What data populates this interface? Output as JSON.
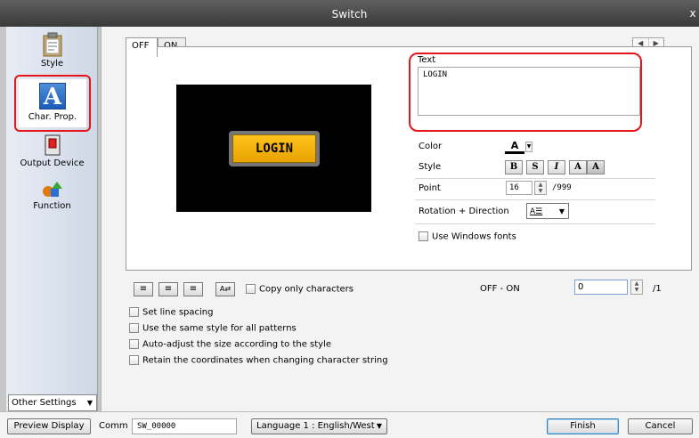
{
  "window": {
    "title": "Switch",
    "close_glyph": "x"
  },
  "sidebar": {
    "items": [
      {
        "label": "Style",
        "icon": "style-icon"
      },
      {
        "label": "Char. Prop.",
        "icon": "char-prop-icon"
      },
      {
        "label": "Output Device",
        "icon": "output-device-icon"
      },
      {
        "label": "Function",
        "icon": "function-icon"
      }
    ],
    "other_settings": "Other Settings"
  },
  "tabs": {
    "off": "OFF",
    "on": "ON"
  },
  "preview": {
    "button_text": "LOGIN"
  },
  "text_section": {
    "label": "Text",
    "value": "LOGIN"
  },
  "properties": {
    "color_label": "Color",
    "color_glyph": "A",
    "style_label": "Style",
    "style_buttons": [
      "B",
      "S",
      "I",
      "A",
      "A"
    ],
    "point_label": "Point",
    "point_value": "16",
    "point_max": "/999",
    "rotation_label": "Rotation + Direction",
    "rotation_glyph": "A☰",
    "use_windows_fonts": "Use Windows fonts"
  },
  "alignment": {
    "buttons": [
      "≡",
      "≡",
      "≡",
      "A⇄"
    ],
    "copy_only_chars": "Copy only characters"
  },
  "offon": {
    "label": "OFF - ON",
    "value": "0",
    "max": "/1"
  },
  "checkboxes": [
    "Set line spacing",
    "Use the same style for all patterns",
    "Auto-adjust the size according to the style",
    "Retain the coordinates when changing character string"
  ],
  "bottom": {
    "preview_display": "Preview Display",
    "comm_label": "Comm",
    "comm_value": "SW_00000",
    "language": "Language 1 : English/West",
    "finish": "Finish",
    "cancel": "Cancel"
  },
  "colors": {
    "highlight": "#e8141b",
    "preview_bg": "#000000",
    "login_face": "#ffc21d",
    "titlebar": "#4a4a4a"
  }
}
